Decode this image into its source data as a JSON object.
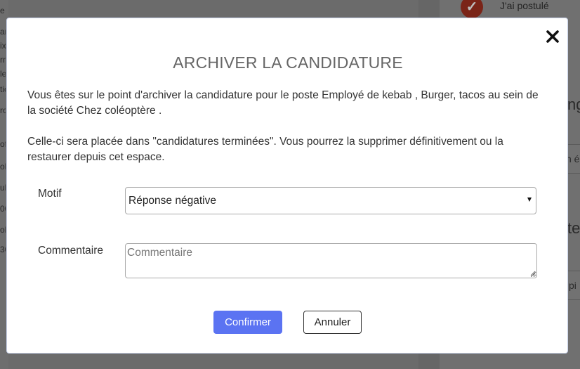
{
  "background": {
    "left_fragments": [
      "e :",
      "ar",
      "ix",
      "rn",
      "le",
      "tic",
      "ro",
      "of",
      "ol",
      "ul",
      "00",
      "ol",
      "30"
    ],
    "status_text": "J'ai postulé",
    "right_fragments": [
      "ng",
      "n é",
      "te",
      "pi"
    ]
  },
  "modal": {
    "title": "ARCHIVER LA CANDIDATURE",
    "paragraph1": "Vous êtes sur le point d'archiver la candidature pour le poste Employé de kebab , Burger, tacos au sein de la société Chez coléoptère .",
    "paragraph2": "Celle-ci sera placée dans \"candidatures terminées\". Vous pourrez la supprimer définitivement ou la restaurer depuis cet espace.",
    "motif": {
      "label": "Motif",
      "selected": "Réponse négative"
    },
    "comment": {
      "label": "Commentaire",
      "placeholder": "Commentaire",
      "value": ""
    },
    "buttons": {
      "confirm": "Confirmer",
      "cancel": "Annuler"
    }
  },
  "colors": {
    "primary": "#5b73f2",
    "title": "#666666",
    "text": "#333333",
    "overlay": "#6b6b6b"
  }
}
